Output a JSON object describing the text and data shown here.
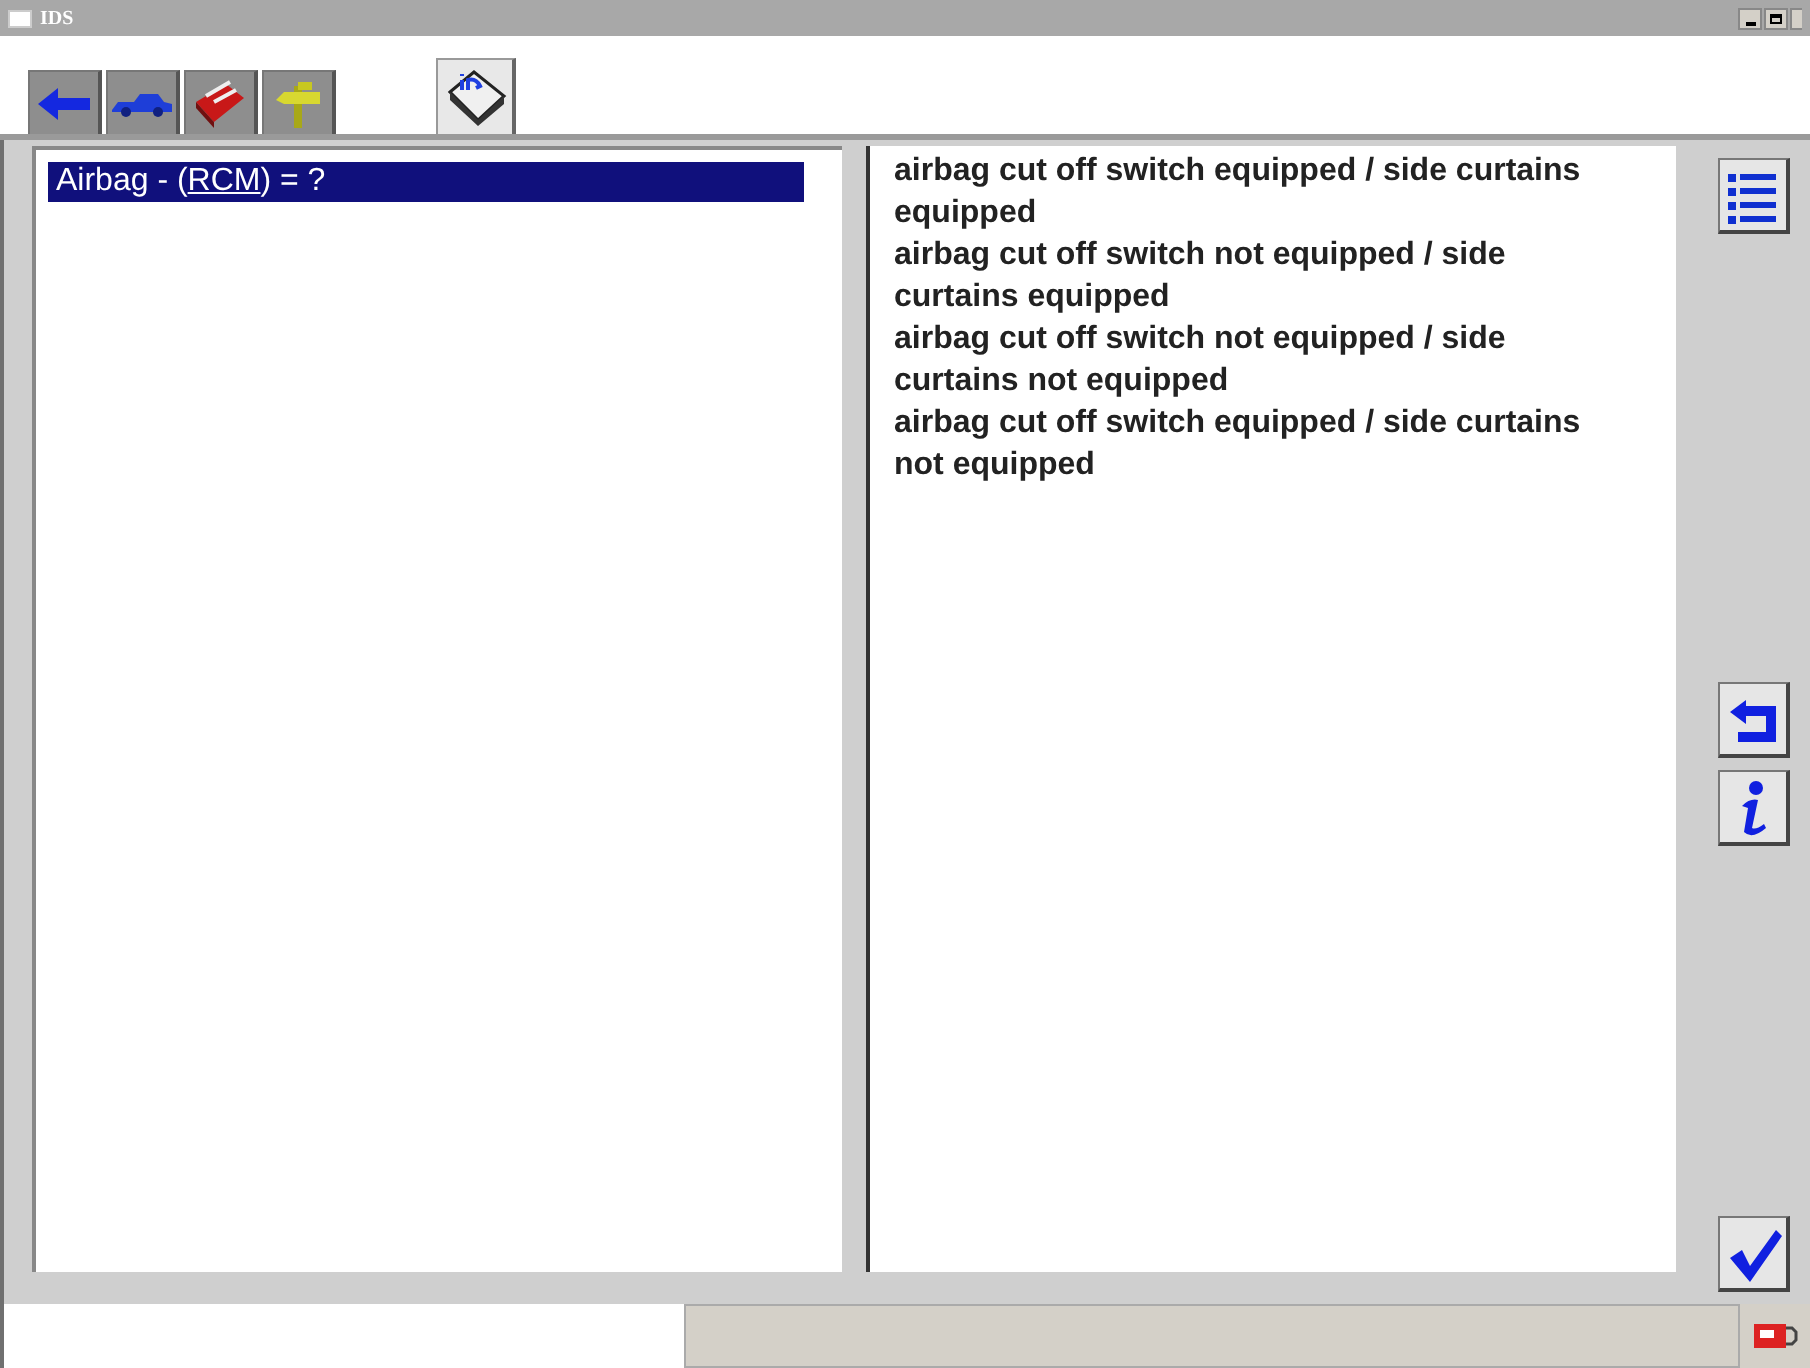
{
  "window": {
    "title": "IDS"
  },
  "tabs": [
    {
      "kind": "back",
      "selected": false
    },
    {
      "kind": "vehicle",
      "selected": false
    },
    {
      "kind": "toolbox",
      "selected": false
    },
    {
      "kind": "signpost",
      "selected": false
    },
    {
      "kind": "info-book",
      "selected": true
    }
  ],
  "question": {
    "prefix": "Airbag - (",
    "link": "RCM",
    "suffix": ") = ?",
    "selected": true
  },
  "options": [
    {
      "text": "airbag cut off switch equipped / side curtains equipped"
    },
    {
      "text": "airbag cut off switch not equipped / side curtains equipped"
    },
    {
      "text": "airbag cut off switch not equipped / side curtains not equipped"
    },
    {
      "text": "airbag cut off switch equipped / side curtains not equipped"
    }
  ],
  "side_buttons": [
    {
      "kind": "list"
    },
    {
      "kind": "return"
    },
    {
      "kind": "info"
    },
    {
      "kind": "tick"
    }
  ]
}
